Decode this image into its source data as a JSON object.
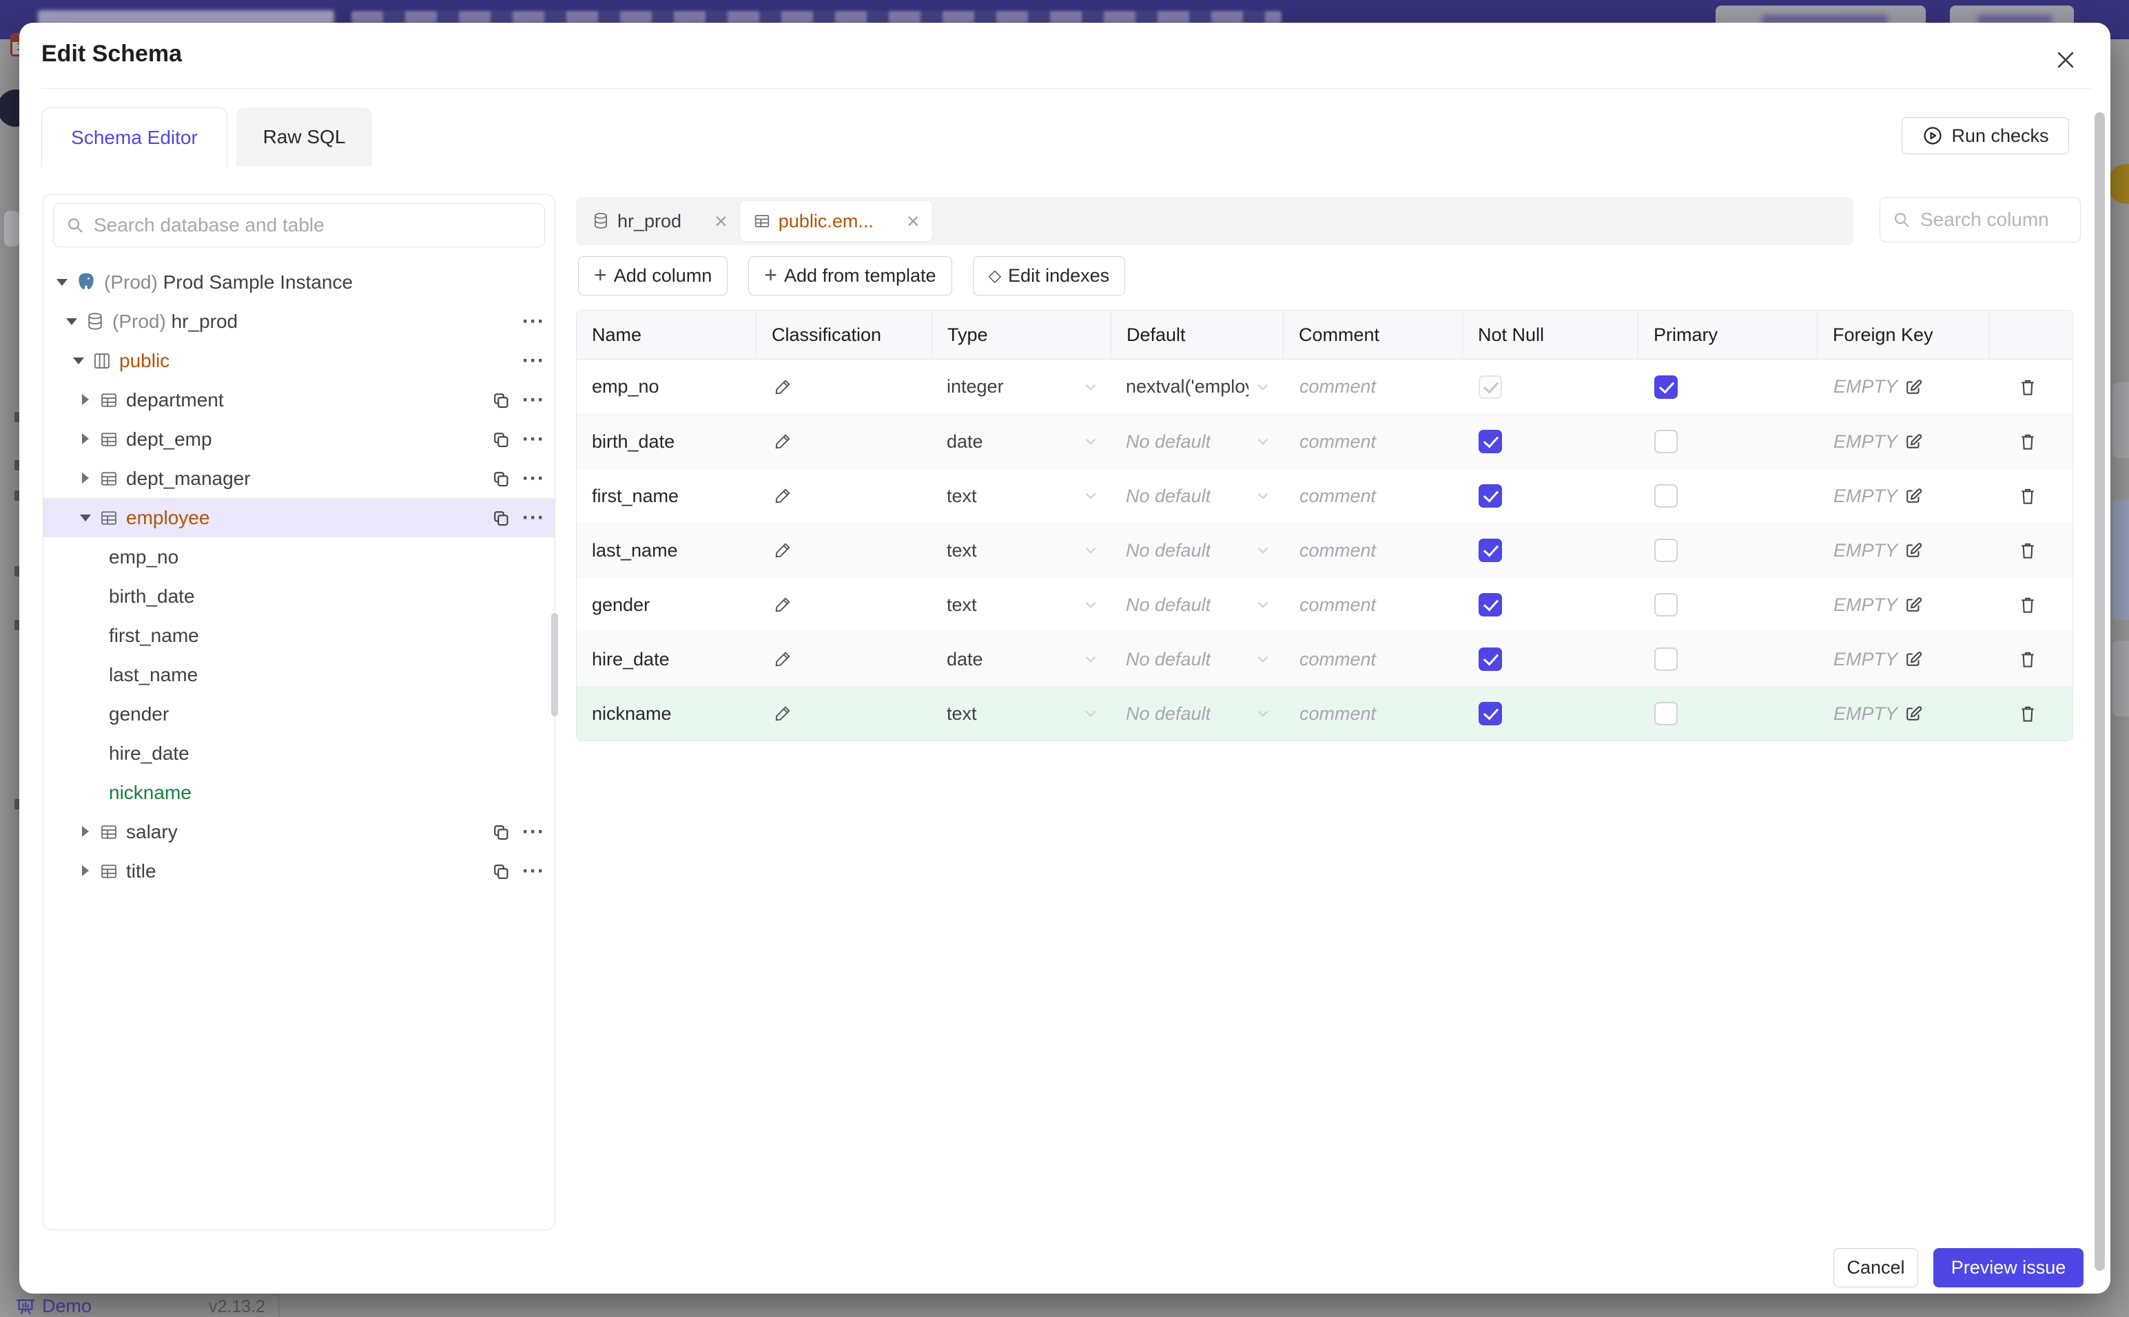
{
  "modal": {
    "title": "Edit Schema",
    "tabs": [
      {
        "label": "Schema Editor",
        "active": true
      },
      {
        "label": "Raw SQL",
        "active": false
      }
    ],
    "run_checks_label": "Run checks",
    "footer": {
      "cancel_label": "Cancel",
      "submit_label": "Preview issue"
    }
  },
  "sidebar": {
    "search_placeholder": "Search database and table",
    "tree": [
      {
        "prefix": "(Prod) ",
        "label": "Prod Sample Instance",
        "type": "instance"
      },
      {
        "prefix": "(Prod) ",
        "label": "hr_prod",
        "type": "database"
      },
      {
        "label": "public",
        "type": "schema"
      },
      {
        "label": "department",
        "type": "table"
      },
      {
        "label": "dept_emp",
        "type": "table"
      },
      {
        "label": "dept_manager",
        "type": "table"
      },
      {
        "label": "employee",
        "type": "table",
        "selected": true
      },
      {
        "label": "emp_no",
        "type": "column"
      },
      {
        "label": "birth_date",
        "type": "column"
      },
      {
        "label": "first_name",
        "type": "column"
      },
      {
        "label": "last_name",
        "type": "column"
      },
      {
        "label": "gender",
        "type": "column"
      },
      {
        "label": "hire_date",
        "type": "column"
      },
      {
        "label": "nickname",
        "type": "column",
        "added": true
      },
      {
        "label": "salary",
        "type": "table"
      },
      {
        "label": "title",
        "type": "table"
      }
    ]
  },
  "editor": {
    "open_tabs": [
      {
        "label": "hr_prod",
        "icon": "database",
        "active": false
      },
      {
        "label": "public.em...",
        "icon": "table",
        "active": true
      }
    ],
    "toolbar": {
      "add_column": "Add column",
      "add_from_template": "Add from template",
      "edit_indexes": "Edit indexes"
    },
    "column_search_placeholder": "Search column"
  },
  "table": {
    "headers": [
      "Name",
      "Classification",
      "Type",
      "Default",
      "Comment",
      "Not Null",
      "Primary",
      "Foreign Key"
    ],
    "comment_placeholder": "comment",
    "foreign_key_empty": "EMPTY",
    "rows": [
      {
        "name": "emp_no",
        "type": "integer",
        "default": "nextval('employ",
        "has_default": true,
        "not_null": true,
        "not_null_disabled": true,
        "primary": true,
        "foreign_key": "EMPTY"
      },
      {
        "name": "birth_date",
        "type": "date",
        "default": "No default",
        "has_default": false,
        "not_null": true,
        "primary": false,
        "foreign_key": "EMPTY"
      },
      {
        "name": "first_name",
        "type": "text",
        "default": "No default",
        "has_default": false,
        "not_null": true,
        "primary": false,
        "foreign_key": "EMPTY"
      },
      {
        "name": "last_name",
        "type": "text",
        "default": "No default",
        "has_default": false,
        "not_null": true,
        "primary": false,
        "foreign_key": "EMPTY"
      },
      {
        "name": "gender",
        "type": "text",
        "default": "No default",
        "has_default": false,
        "not_null": true,
        "primary": false,
        "foreign_key": "EMPTY"
      },
      {
        "name": "hire_date",
        "type": "date",
        "default": "No default",
        "has_default": false,
        "not_null": true,
        "primary": false,
        "foreign_key": "EMPTY"
      },
      {
        "name": "nickname",
        "type": "text",
        "default": "No default",
        "has_default": false,
        "not_null": true,
        "primary": false,
        "foreign_key": "EMPTY",
        "added": true
      }
    ]
  },
  "statusbar": {
    "demo_label": "Demo",
    "version": "v2.13.2"
  },
  "colors": {
    "accent": "#4f46e5",
    "selected_table_text": "#b45309",
    "added_column_text": "#15803d",
    "topbar": "#37347e"
  }
}
